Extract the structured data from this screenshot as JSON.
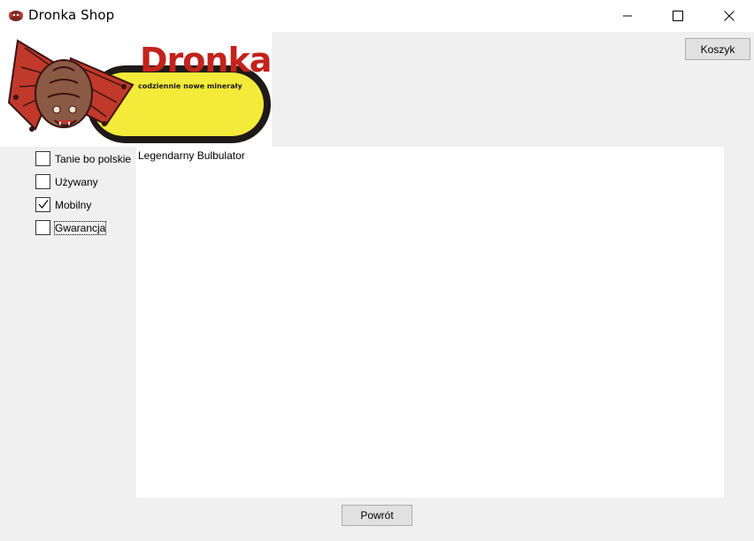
{
  "window": {
    "title": "Dronka Shop",
    "controls": {
      "minimize": "minimize-icon",
      "maximize": "maximize-icon",
      "close": "close-icon"
    }
  },
  "logo": {
    "title": "Dronka",
    "subtitle": "codziennie nowe minerały"
  },
  "toolbar": {
    "cart_label": "Koszyk"
  },
  "filters": [
    {
      "label": "Tanie bo polskie",
      "checked": false
    },
    {
      "label": "Używany",
      "checked": false
    },
    {
      "label": "Mobilny",
      "checked": true
    },
    {
      "label": "Gwarancja",
      "checked": false,
      "focused": true
    }
  ],
  "content": {
    "items": [
      "Legendarny Bulbulator"
    ]
  },
  "footer": {
    "back_label": "Powrót"
  },
  "colors": {
    "background": "#f0f0f0",
    "button_bg": "#e1e1e1",
    "logo_yellow": "#f4ea3a",
    "logo_red": "#c2231c"
  }
}
